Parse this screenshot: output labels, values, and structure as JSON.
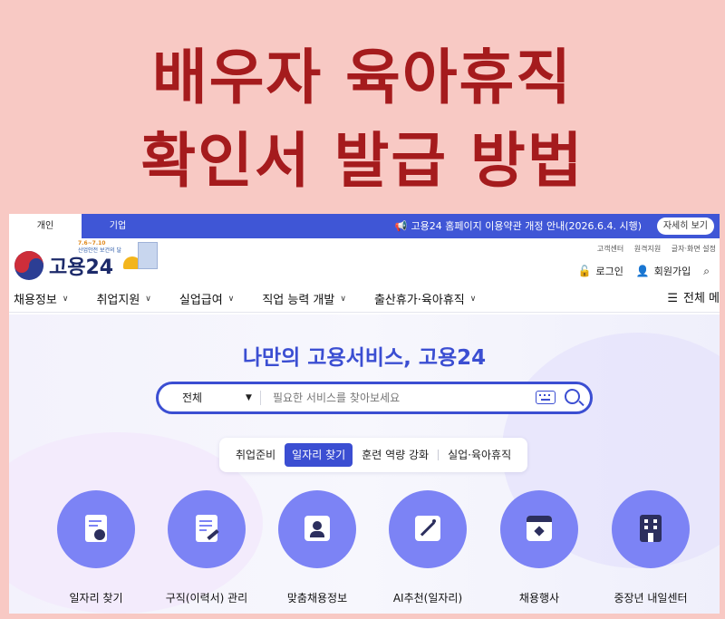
{
  "headline": {
    "line1": "배우자 육아휴직",
    "line2": "확인서 발급 방법"
  },
  "topbar": {
    "tab_personal": "개인",
    "tab_company": "기업",
    "notice_icon": "megaphone-icon",
    "notice": "고용24 홈페이지 이용약관 개정 안내(2026.6.4. 시행)",
    "detail_button": "자세히 보기"
  },
  "header": {
    "logo_text": "고용24",
    "badge_dates": "7.6~7.10",
    "badge_text": "산업안전 보건의 달",
    "util": [
      "고객센터",
      "원격지원",
      "글자·화면 설정"
    ],
    "login": "로그인",
    "signup": "회원가입"
  },
  "nav": {
    "items": [
      "채용정보",
      "취업지원",
      "실업급여",
      "직업 능력 개발",
      "출산휴가·육아휴직"
    ],
    "all_menu": "전체 메"
  },
  "hero": {
    "title": "나만의 고용서비스, 고용24",
    "search_select": "전체",
    "search_placeholder": "필요한 서비스를 찾아보세요",
    "chips": [
      "취업준비",
      "일자리 찾기",
      "훈련 역량 강화",
      "실업·육아휴직"
    ],
    "active_chip": "일자리 찾기"
  },
  "services": [
    {
      "label": "일자리 찾기",
      "icon": "job-search-icon"
    },
    {
      "label": "구직(이력서) 관리",
      "icon": "resume-check-icon"
    },
    {
      "label": "맞춤채용정보",
      "icon": "puzzle-person-icon"
    },
    {
      "label": "AI추천(일자리)",
      "icon": "magic-wand-icon"
    },
    {
      "label": "채용행사",
      "icon": "calendar-star-icon"
    },
    {
      "label": "중장년 내일센터",
      "icon": "building-icon"
    }
  ],
  "colors": {
    "background": "#f8c9c4",
    "headline": "#a51b1d",
    "primary": "#3b4ed2",
    "service_circle": "#7c83f5"
  }
}
